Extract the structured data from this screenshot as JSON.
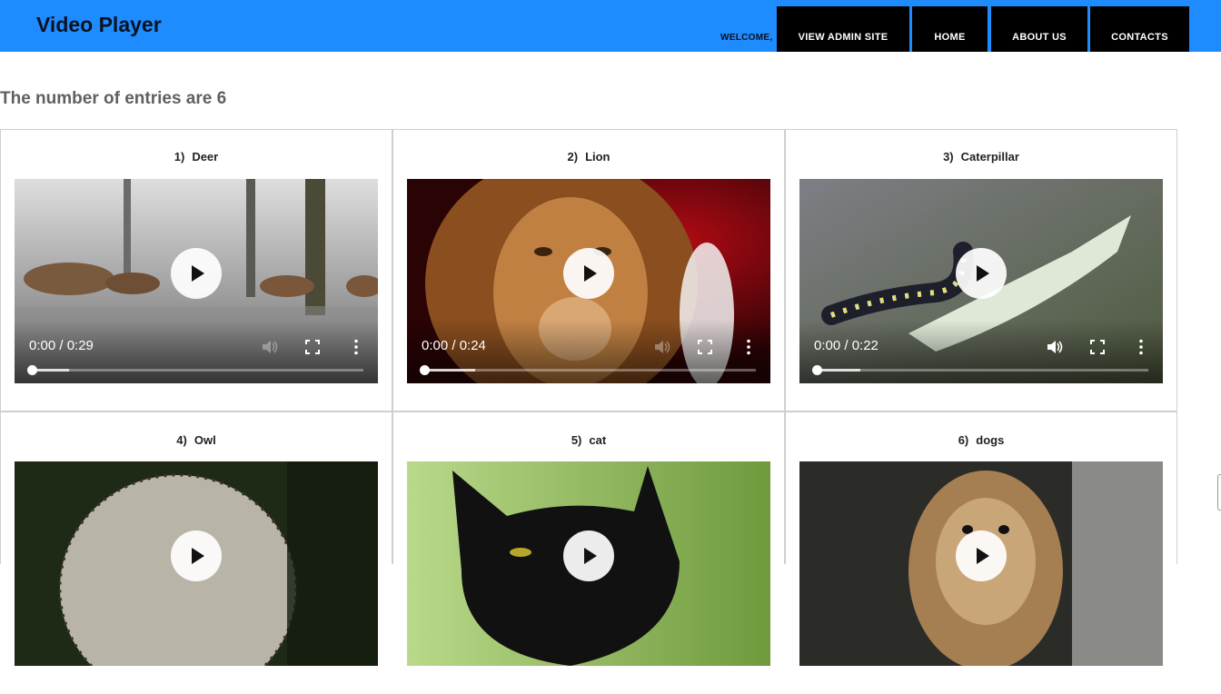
{
  "header": {
    "title": "Video Player",
    "welcome": "WELCOME,",
    "nav": [
      "VIEW ADMIN SITE",
      "HOME",
      "ABOUT US",
      "CONTACTS"
    ],
    "bar_color": "#1e8bff"
  },
  "summary": {
    "text": "The number of entries are 6"
  },
  "videos": [
    {
      "num": "1)",
      "name": "Deer",
      "time": "0:00 / 0:29",
      "muted_look": true,
      "buffered": 0.11
    },
    {
      "num": "2)",
      "name": "Lion",
      "time": "0:00 / 0:24",
      "muted_look": true,
      "buffered": 0.15
    },
    {
      "num": "3)",
      "name": "Caterpillar",
      "time": "0:00 / 0:22",
      "muted_look": false,
      "buffered": 0.13
    },
    {
      "num": "4)",
      "name": "Owl",
      "time": "",
      "muted_look": false,
      "buffered": 0
    },
    {
      "num": "5)",
      "name": "cat",
      "time": "",
      "muted_look": false,
      "buffered": 0
    },
    {
      "num": "6)",
      "name": "dogs",
      "time": "",
      "muted_look": false,
      "buffered": 0
    }
  ],
  "icons": {
    "play": "play-icon",
    "volume": "volume-icon",
    "fullscreen": "fullscreen-icon",
    "menu": "more-vertical-icon"
  }
}
